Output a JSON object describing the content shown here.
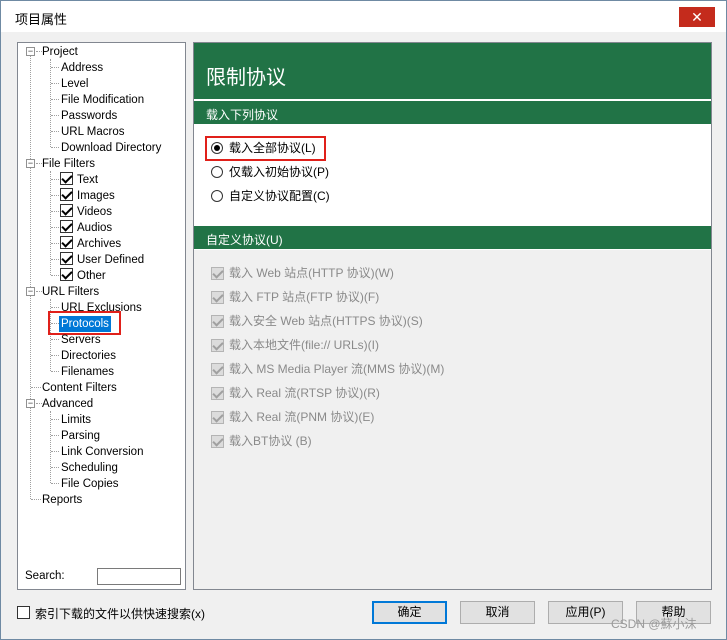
{
  "window": {
    "title": "项目属性",
    "close_glyph": "✕"
  },
  "tree": {
    "project": "Project",
    "project_children": [
      "Address",
      "Level",
      "File Modification",
      "Passwords",
      "URL Macros",
      "Download Directory"
    ],
    "file_filters": "File Filters",
    "file_filter_children": [
      "Text",
      "Images",
      "Videos",
      "Audios",
      "Archives",
      "User Defined",
      "Other"
    ],
    "url_filters": "URL Filters",
    "url_filter_children": [
      "URL Exclusions",
      "Protocols",
      "Servers",
      "Directories",
      "Filenames"
    ],
    "content_filters": "Content Filters",
    "advanced": "Advanced",
    "advanced_children": [
      "Limits",
      "Parsing",
      "Link Conversion",
      "Scheduling",
      "File Copies"
    ],
    "reports": "Reports",
    "expander_glyph": "−",
    "selected": "Protocols"
  },
  "search": {
    "label": "Search:",
    "value": ""
  },
  "panel": {
    "title": "限制协议",
    "section1": "载入下列协议",
    "radios": [
      {
        "label": "载入全部协议(L)",
        "checked": true
      },
      {
        "label": "仅载入初始协议(P)",
        "checked": false
      },
      {
        "label": "自定义协议配置(C)",
        "checked": false
      }
    ],
    "section2": "自定义协议(U)",
    "custom_protocols": [
      "载入 Web 站点(HTTP 协议)(W)",
      "载入 FTP 站点(FTP 协议)(F)",
      "载入安全 Web 站点(HTTPS 协议)(S)",
      "载入本地文件(file:// URLs)(I)",
      "载入 MS Media Player 流(MMS 协议)(M)",
      "载入 Real 流(RTSP 协议)(R)",
      "载入 Real 流(PNM 协议)(E)",
      "载入BT协议 (B)"
    ]
  },
  "footer": {
    "index_checkbox_label": "索引下载的文件以供快速搜索(x)",
    "ok": "确定",
    "cancel": "取消",
    "apply": "应用(P)",
    "help": "帮助"
  },
  "watermark": "CSDN @蘇小沫",
  "colors": {
    "accent_green": "#217346",
    "selection_blue": "#0078d7",
    "highlight_red": "#e0201a",
    "close_red": "#c42b1c"
  }
}
